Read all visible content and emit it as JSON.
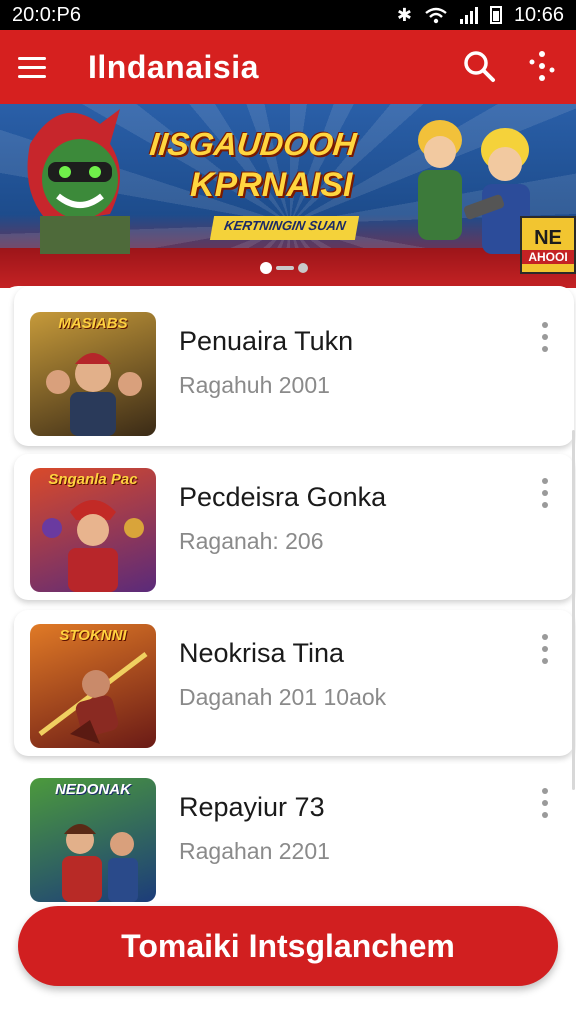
{
  "status_bar": {
    "time_left": "20:0:P6",
    "time_right": "10:66"
  },
  "app_bar": {
    "title": "Ilndanaisia"
  },
  "banner": {
    "title_line1": "IISGAUDOOH",
    "title_line2": "KPRNAISI",
    "tagline": "KERTNINGIN SUAN",
    "badge_top": "NE",
    "badge_bottom": "AHOOI"
  },
  "games": [
    {
      "title": "Penuaira Tukn",
      "subtitle": "Ragahuh 2001",
      "thumb_label": "MASIABS",
      "colors": [
        "#3a2a16",
        "#c69a3a"
      ]
    },
    {
      "title": "Pecdeisra Gonka",
      "subtitle": "Raganah: 206",
      "thumb_label": "Snganla Pac",
      "colors": [
        "#5a2a7a",
        "#d94a2a"
      ]
    },
    {
      "title": "Neokrisa Tina",
      "subtitle": "Daganah 201 10aok",
      "thumb_label": "STOKNNI",
      "colors": [
        "#6a1a16",
        "#e07a26"
      ]
    },
    {
      "title": "Repayiur 73",
      "subtitle": "Ragahan 2201",
      "thumb_label": "NEDONAK",
      "colors": [
        "#1c3c7a",
        "#4c9a3c"
      ]
    }
  ],
  "cta": {
    "label": "Tomaiki Intsglanchem"
  },
  "theme": {
    "primary": "#d6201f",
    "on_primary": "#ffffff"
  },
  "icons": {
    "menu": "hamburger-icon",
    "search": "search-icon",
    "more": "more-icon",
    "kebab": "kebab-icon"
  }
}
